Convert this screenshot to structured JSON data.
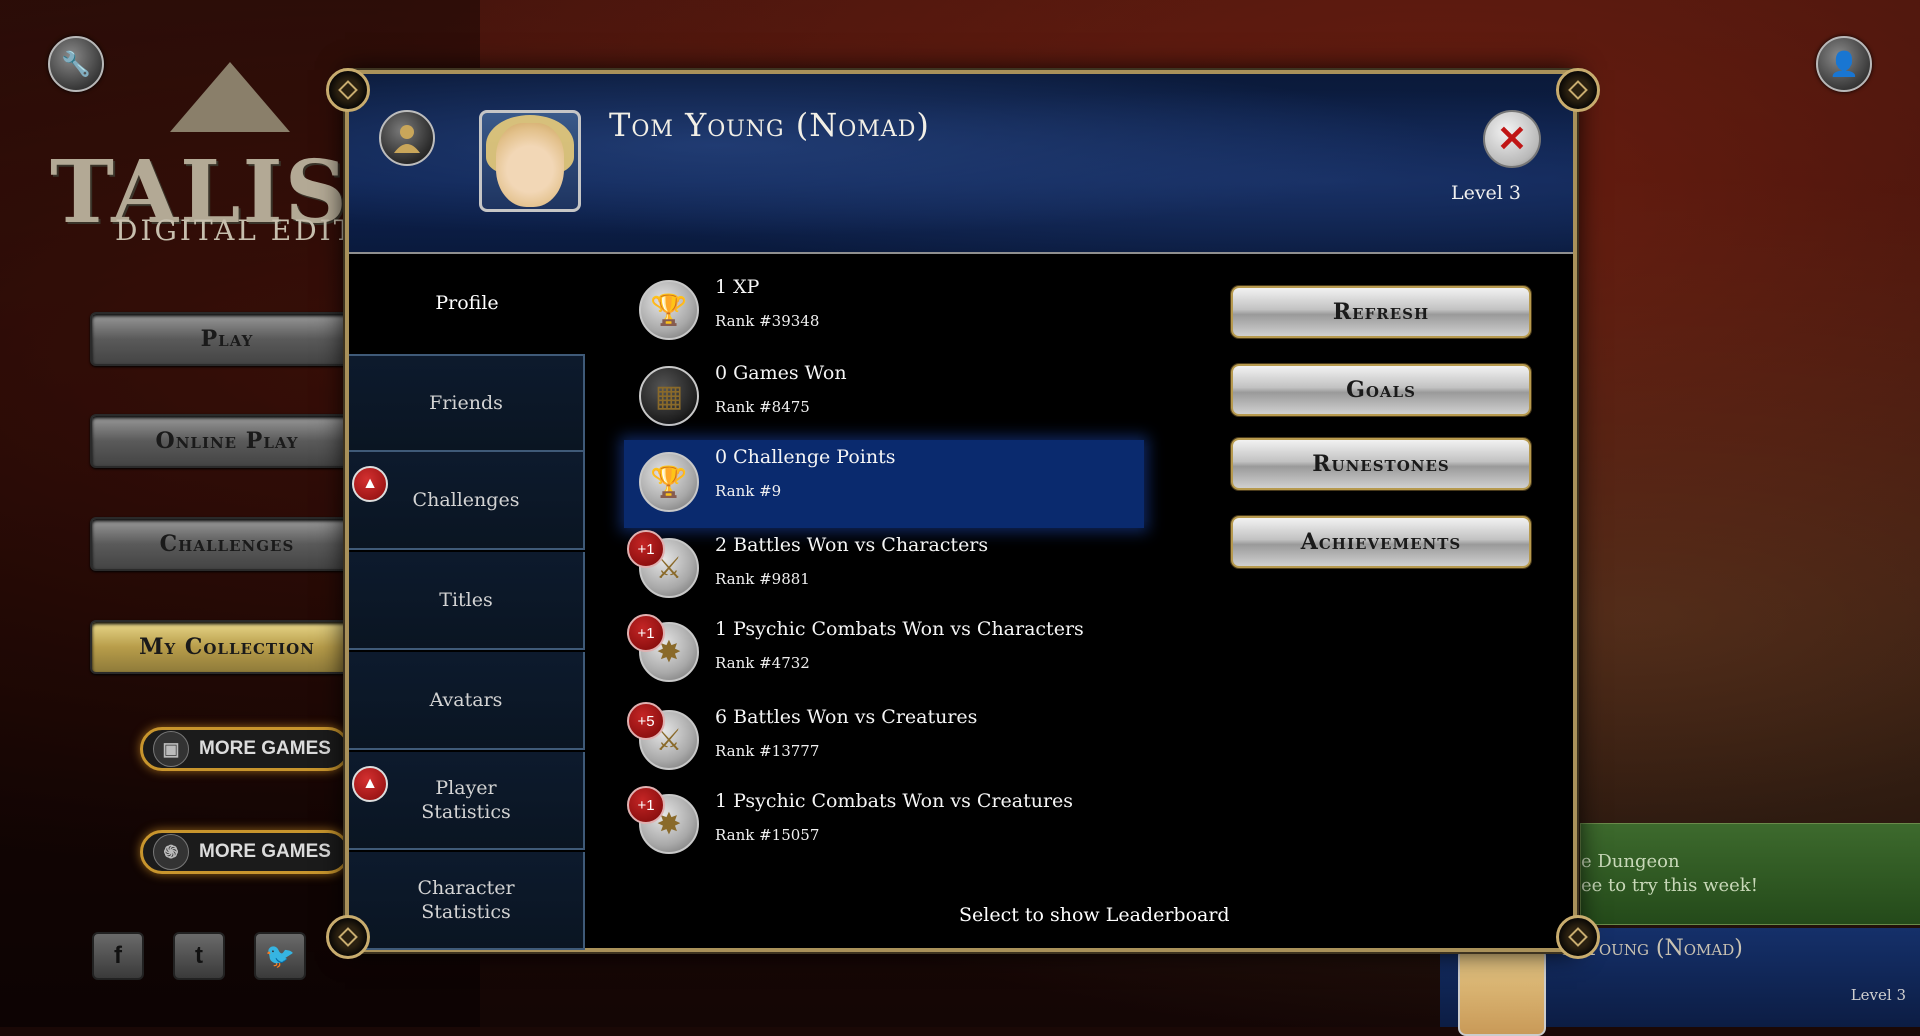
{
  "background": {
    "logo_title": "TALISMA",
    "logo_subtitle": "DIGITAL EDITIO",
    "menu": [
      "Play",
      "Online Play",
      "Challenges",
      "My Collection"
    ],
    "more_games_1": "MORE GAMES",
    "more_games_2": "MORE GAMES",
    "social": [
      "f",
      "t",
      "🐦"
    ],
    "promo_text": "e Dungeon\nee to try this week!",
    "profile_name": "m Young (Nomad)",
    "profile_level": "Level 3"
  },
  "dialog": {
    "player_name": "Tom Young (Nomad)",
    "level": "Level 3",
    "close_icon": "✕",
    "sidebar": [
      {
        "label": "Profile",
        "active": true,
        "badge": false
      },
      {
        "label": "Friends",
        "active": false,
        "badge": false
      },
      {
        "label": "Challenges",
        "active": false,
        "badge": true
      },
      {
        "label": "Titles",
        "active": false,
        "badge": false
      },
      {
        "label": "Avatars",
        "active": false,
        "badge": false
      },
      {
        "label": "Player Statistics",
        "active": false,
        "badge": true
      },
      {
        "label": "Character Statistics",
        "active": false,
        "badge": false
      }
    ],
    "stats": [
      {
        "title": "1 XP",
        "rank": "Rank #39348",
        "icon": "trophy-icon",
        "badge": ""
      },
      {
        "title": "0 Games Won",
        "rank": "Rank #8475",
        "icon": "board-icon",
        "badge": ""
      },
      {
        "title": "0 Challenge Points",
        "rank": "Rank #9",
        "icon": "trophy-icon",
        "badge": "",
        "selected": true
      },
      {
        "title": "2 Battles Won vs Characters",
        "rank": "Rank #9881",
        "icon": "swords-icon",
        "badge": "+1"
      },
      {
        "title": "1 Psychic Combats Won vs Characters",
        "rank": "Rank #4732",
        "icon": "star-burst-icon",
        "badge": "+1"
      },
      {
        "title": "6 Battles Won vs Creatures",
        "rank": "Rank #13777",
        "icon": "swords-icon",
        "badge": "+5"
      },
      {
        "title": "1 Psychic Combats Won vs Creatures",
        "rank": "Rank #15057",
        "icon": "star-burst-icon",
        "badge": "+1"
      }
    ],
    "hint": "Select to show Leaderboard",
    "actions": {
      "refresh": "Refresh",
      "goals": "Goals",
      "runestones": "Runestones",
      "achievements": "Achievements"
    }
  },
  "colors": {
    "highlight": "#0a2a6e",
    "frame_gold": "#a9915a",
    "badge_red": "#c42525"
  }
}
